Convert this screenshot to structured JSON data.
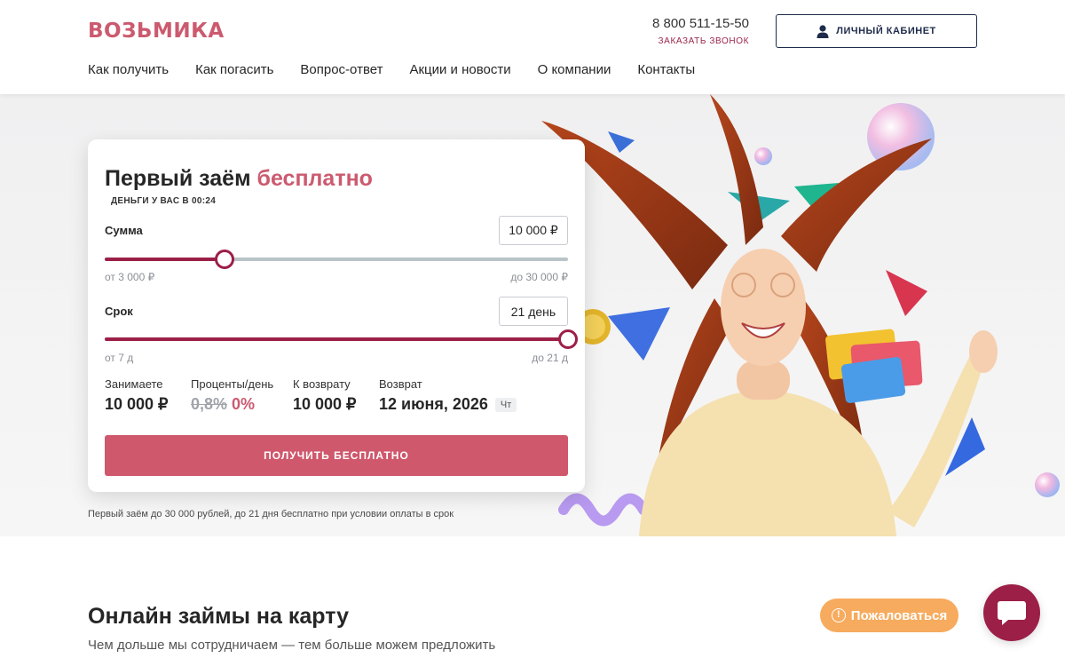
{
  "header": {
    "logo": "ВОЗЬМИКА",
    "phone": "8 800 511-15-50",
    "callback_link": "ЗАКАЗАТЬ ЗВОНОК",
    "cabinet_button": "ЛИЧНЫЙ КАБИНЕТ",
    "cabinet_icon": "user-icon"
  },
  "nav": {
    "items": [
      "Как получить",
      "Как погасить",
      "Вопрос-ответ",
      "Акции и новости",
      "О компании",
      "Контакты"
    ]
  },
  "calculator": {
    "title_main": "Первый заём",
    "title_accent": "бесплатно",
    "subtitle": "ДЕНЬГИ У ВАС В 00:24",
    "amount": {
      "label": "Сумма",
      "value": "10 000 ₽",
      "min_label": "от 3 000 ₽",
      "max_label": "до 30 000 ₽",
      "current": 10000,
      "min": 3000,
      "max": 30000
    },
    "term": {
      "label": "Срок",
      "value": "21 день",
      "min_label": "от 7 д",
      "max_label": "до 21 д",
      "current": 21,
      "min": 7,
      "max": 21
    },
    "summary": {
      "borrow_label": "Занимаете",
      "borrow_value": "10 000 ₽",
      "rate_label": "Проценты/день",
      "rate_old": "0,8%",
      "rate_new": "0%",
      "repay_label": "К возврату",
      "repay_value": "10 000 ₽",
      "return_label": "Возврат",
      "return_date": "12 июня, 2026",
      "return_weekday": "Чт"
    },
    "cta": "ПОЛУЧИТЬ БЕСПЛАТНО"
  },
  "disclaimer": "Первый заём до 30 000 рублей, до 21 дня бесплатно при условии оплаты в срок",
  "section": {
    "title": "Онлайн займы на карту",
    "subtitle": "Чем дольше мы сотрудничаем — тем больше можем предложить"
  },
  "complain_button": "Пожаловаться",
  "chat_icon": "chat-bubble-icon",
  "colors": {
    "brand": "#cc5a6f",
    "accent_dark": "#9c1f48",
    "navy": "#1e2b4a",
    "complain": "#f6ab5e"
  }
}
